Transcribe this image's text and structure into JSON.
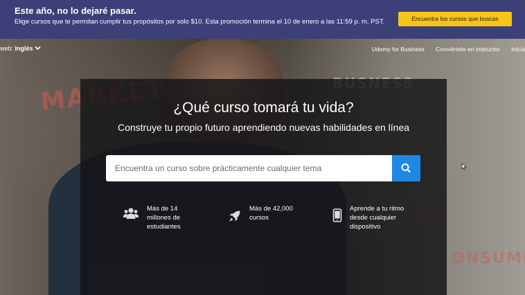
{
  "promo": {
    "title": "Este año, no lo dejaré pasar.",
    "text": "Elige cursos que te permitan cumplir tus propósitos por solo $10. Esta promoción termina el 10 de enero a las 11:59 p. m. PST.",
    "button": "Encuentra los cursos que buscas",
    "colors": {
      "background": "#3d3f78",
      "button": "#f5c518"
    }
  },
  "nav": {
    "lang_prefix": "web:",
    "lang_value": "Inglés",
    "links": [
      "Udemy for Business",
      "Conviértete en instructor",
      "Inicia"
    ]
  },
  "hero": {
    "headline": "¿Qué curso tomará tu vida?",
    "subline": "Construye tu propio futuro aprendiendo nuevas habilidades en línea",
    "search": {
      "placeholder": "Encuentra un curso sobre prácticamente cualquier tema",
      "button_color": "#1e88e5"
    },
    "features": [
      {
        "icon": "users-icon",
        "text": "Más de 14 millones de estudiantes"
      },
      {
        "icon": "rocket-icon",
        "text": "Más de 42,000 cursos"
      },
      {
        "icon": "phone-icon",
        "text": "Aprende a tu ritmo desde cualquier dispositivo"
      }
    ]
  }
}
